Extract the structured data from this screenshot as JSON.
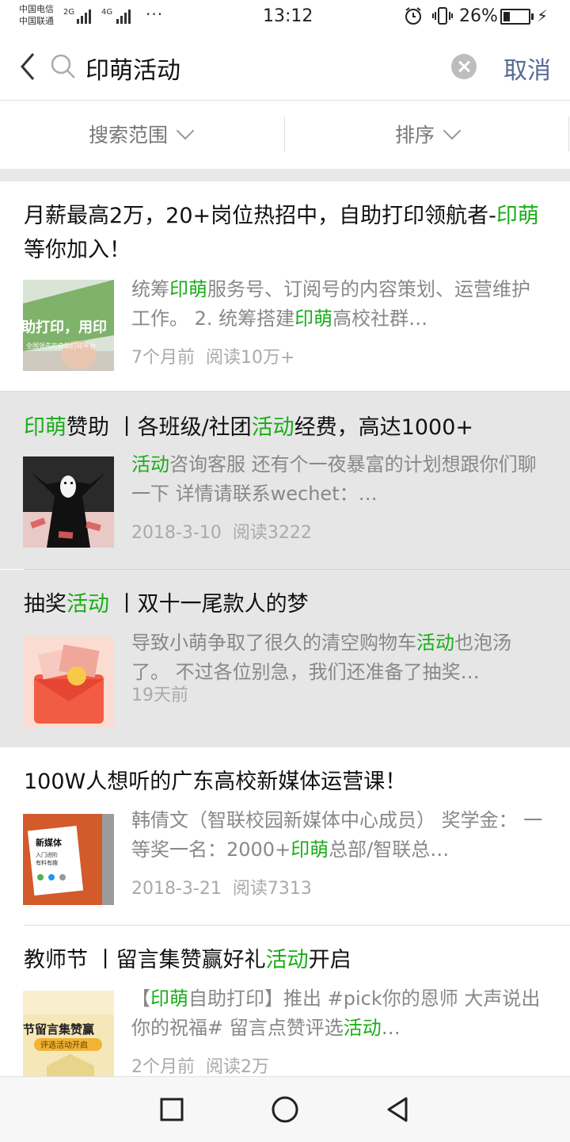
{
  "status_bar": {
    "carrier1": "中国电信",
    "carrier2": "中国联通",
    "net1": "2G",
    "net2": "4G",
    "more": "···",
    "time": "13:12",
    "battery_pct": "26%",
    "battery_level": 0.26
  },
  "search": {
    "query": "印萌活动",
    "cancel_label": "取消"
  },
  "filters": {
    "scope_label": "搜索范围",
    "sort_label": "排序"
  },
  "results": [
    {
      "title_segs": [
        "月薪最高2万，20+岗位热招中，自助打印领航者-",
        "印萌",
        "等你加入！"
      ],
      "snippet_segs": [
        "统筹",
        "印萌",
        "服务号、订阅号的内容策划、运营维护工作。 2. 统筹搭建",
        "印萌",
        "高校社群…"
      ],
      "thumb_texts": [
        "助打印，用印",
        "全国领先的自助打印平台"
      ],
      "date": "7个月前",
      "reads": "阅读10万+"
    },
    {
      "title_segs": [
        "印萌",
        "赞助 丨各班级/社团",
        "活动",
        "经费，高达1000+"
      ],
      "snippet_segs": [
        "活动",
        "咨询客服 还有个一夜暴富的计划想跟你们聊一下 详情请联系wechet：…"
      ],
      "date": "2018-3-10",
      "reads": "阅读3222"
    },
    {
      "title_segs": [
        "抽奖",
        "活动",
        " 丨双十一尾款人的梦"
      ],
      "snippet_segs": [
        "导致小萌争取了很久的清空购物车",
        "活动",
        "也泡汤了。 不过各位别急，我们还准备了抽奖…"
      ],
      "date": "19天前",
      "reads": ""
    },
    {
      "title_segs": [
        "100W人想听的广东高校新媒体运营课！"
      ],
      "snippet_segs": [
        "韩倩文（智联校园新媒体中心成员） 奖学金： 一等奖一名：2000+",
        "印萌",
        "总部/智联总…"
      ],
      "thumb_texts": [
        "新媒体",
        "入门进阶",
        "有料有趣"
      ],
      "date": "2018-3-21",
      "reads": "阅读7313"
    },
    {
      "title_segs": [
        "教师节 丨留言集赞赢好礼",
        "活动",
        "开启"
      ],
      "snippet_segs": [
        "【",
        "印萌",
        "自助打印】推出 #pick你的恩师 大声说出你的祝福# 留言点赞评选",
        "活动",
        "…"
      ],
      "thumb_texts": [
        "节留言集赞赢",
        "评选活动开启"
      ],
      "date": "2个月前",
      "reads": "阅读2万"
    }
  ],
  "icons": {
    "back": "back-arrow-icon",
    "search": "search-icon",
    "clear": "clear-icon",
    "nav": [
      "square-recents-icon",
      "circle-home-icon",
      "triangle-back-icon"
    ]
  },
  "colors": {
    "highlight_green": "#1aad19",
    "cancel_blue": "#576b95",
    "selected_bg": "#e6e6e6"
  }
}
